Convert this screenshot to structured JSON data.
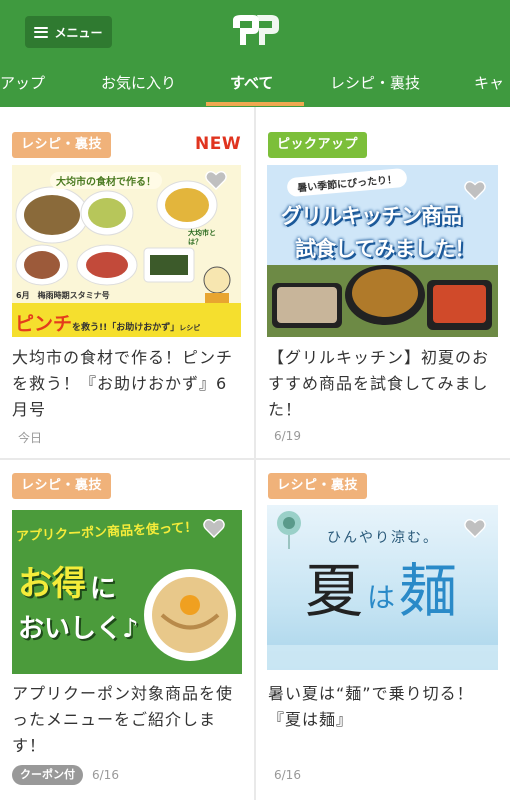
{
  "header": {
    "menu_label": "メニュー",
    "tabs": [
      {
        "label": "アップ"
      },
      {
        "label": "お気に入り"
      },
      {
        "label": "すべて"
      },
      {
        "label": "レシピ・裏技"
      },
      {
        "label": "キャ"
      }
    ]
  },
  "cards": [
    {
      "badge": "レシピ・裏技",
      "new_label": "NEW",
      "image": {
        "headline": "大均市の食材で作る！",
        "side_label": "大均市とは？",
        "issue": "6月　梅雨時期スタミナ号",
        "banner_big": "ピンチ",
        "banner_mid": "を救う!!「お助けおかず」",
        "banner_small": "レシピ"
      },
      "title_lines": [
        "大均市の食材で作る！ピンチ",
        "を救う！『お助けおかず』6",
        "月号"
      ],
      "date": "今日"
    },
    {
      "badge": "ピックアップ",
      "image": {
        "ribbon": "暑い季節にぴったり！",
        "line1": "グリルキッチン商品",
        "line2": "試食してみました！"
      },
      "title_lines": [
        "【グリルキッチン】初夏のお",
        "すすめ商品を試食してみまし",
        "た！"
      ],
      "date": "6/19"
    },
    {
      "badge": "レシピ・裏技",
      "image": {
        "headline": "アプリクーポン商品を使って！",
        "big1": "お得",
        "big1b": "に",
        "big2": "おいしく♪"
      },
      "title_lines": [
        "アプリクーポン対象商品を使",
        "ったメニューをご紹介しま",
        "す！"
      ],
      "coupon_label": "クーポン付",
      "date": "6/16"
    },
    {
      "badge": "レシピ・裏技",
      "image": {
        "subtitle": "ひんやり涼む。",
        "kanji1": "夏",
        "hira": "は",
        "kanji2": "麺"
      },
      "title_lines": [
        "暑い夏は“麺”で乗り切る！",
        "『夏は麺』"
      ],
      "date": "6/16"
    }
  ],
  "colors": {
    "header_green": "#3f9a3f",
    "menu_button": "#2f7a30",
    "tab_underline": "#f0a850",
    "badge_orange": "#f0b27a",
    "badge_green": "#7cbf3a",
    "new_red": "#e0341f"
  },
  "icons": [
    "menu-icon",
    "logo-icon",
    "heart-icon"
  ]
}
